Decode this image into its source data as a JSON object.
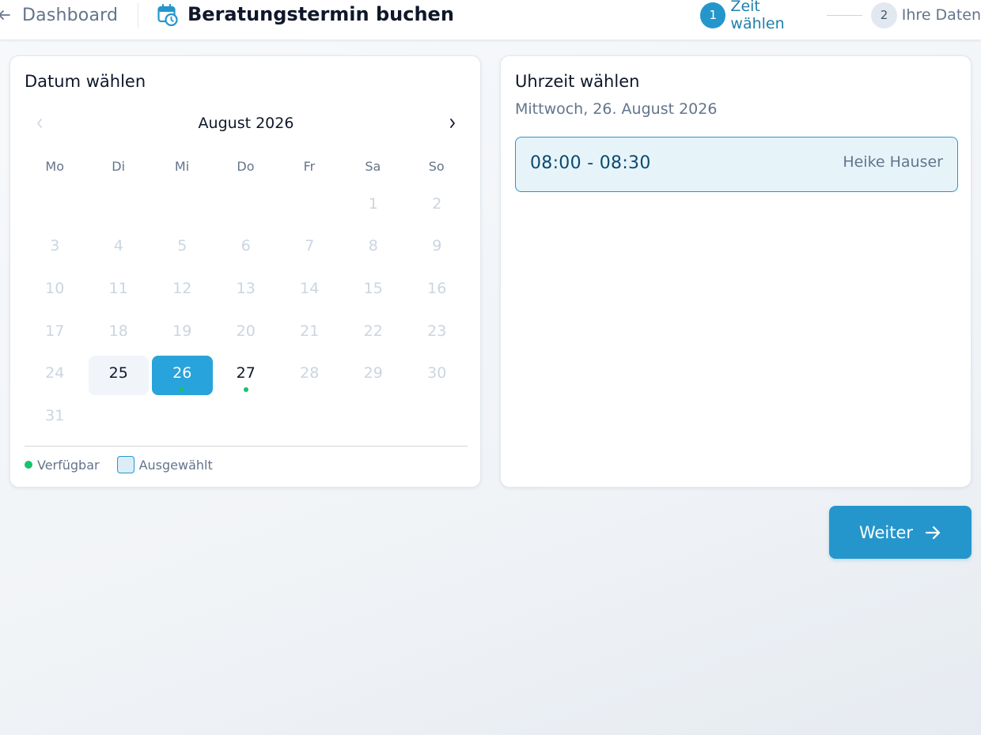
{
  "header": {
    "back_label": "Dashboard",
    "title": "Beratungstermin buchen",
    "steps": [
      {
        "number": "1",
        "label": "Zeit wählen",
        "state": "active"
      },
      {
        "number": "2",
        "label": "Ihre Daten",
        "state": "inactive"
      }
    ]
  },
  "calendar": {
    "title": "Datum wählen",
    "month_label": "August 2026",
    "weekdays": [
      "Mo",
      "Di",
      "Mi",
      "Do",
      "Fr",
      "Sa",
      "So"
    ],
    "leading_blanks": 5,
    "days": [
      {
        "d": "1"
      },
      {
        "d": "2"
      },
      {
        "d": "3"
      },
      {
        "d": "4"
      },
      {
        "d": "5"
      },
      {
        "d": "6"
      },
      {
        "d": "7"
      },
      {
        "d": "8"
      },
      {
        "d": "9"
      },
      {
        "d": "10"
      },
      {
        "d": "11"
      },
      {
        "d": "12"
      },
      {
        "d": "13"
      },
      {
        "d": "14"
      },
      {
        "d": "15"
      },
      {
        "d": "16"
      },
      {
        "d": "17"
      },
      {
        "d": "18"
      },
      {
        "d": "19"
      },
      {
        "d": "20"
      },
      {
        "d": "21"
      },
      {
        "d": "22"
      },
      {
        "d": "23"
      },
      {
        "d": "24"
      },
      {
        "d": "25",
        "available": true,
        "state": "hover"
      },
      {
        "d": "26",
        "available": true,
        "state": "selected",
        "dot": true
      },
      {
        "d": "27",
        "available": true,
        "dot": true
      },
      {
        "d": "28"
      },
      {
        "d": "29"
      },
      {
        "d": "30"
      },
      {
        "d": "31"
      }
    ],
    "legend": {
      "available_label": "Verfügbar",
      "selected_label": "Ausgewählt"
    }
  },
  "time_panel": {
    "title": "Uhrzeit wählen",
    "date_label": "Mittwoch, 26. August 2026",
    "slots": [
      {
        "time": "08:00 - 08:30",
        "advisor": "Heike Hauser",
        "selected": true
      }
    ]
  },
  "footer": {
    "next_label": "Weiter"
  },
  "colors": {
    "accent": "#2596cc",
    "selected_day": "#29a3db",
    "available_dot": "#16c46c"
  }
}
